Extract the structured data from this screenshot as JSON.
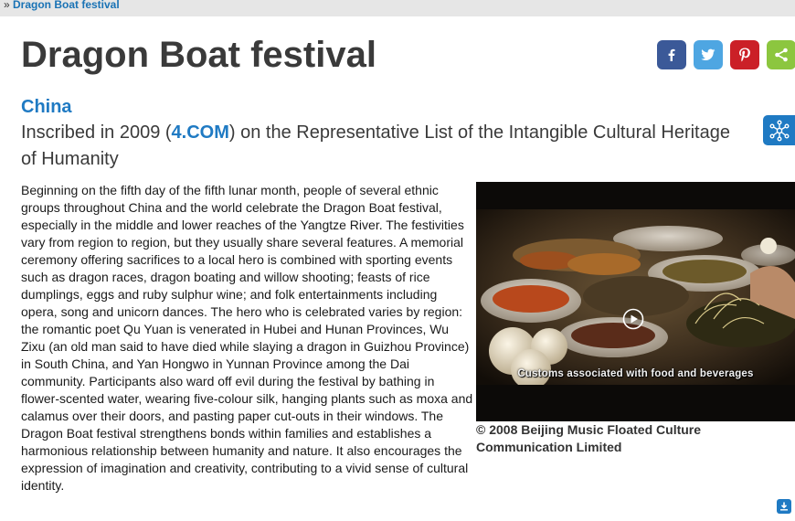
{
  "breadcrumb": {
    "separator": "»",
    "current": "Dragon Boat festival"
  },
  "page": {
    "title": "Dragon Boat festival",
    "country": "China",
    "inscription_prefix": "Inscribed in 2009 (",
    "inscription_link": "4.COM",
    "inscription_suffix": ") on the Representative List of the Intangible Cultural Heritage of Humanity"
  },
  "share": {
    "facebook_icon": "facebook-icon",
    "twitter_icon": "twitter-icon",
    "pinterest_icon": "pinterest-icon",
    "share_icon": "share-icon",
    "colors": {
      "facebook": "#3b5998",
      "twitter": "#4ea6e2",
      "pinterest": "#cb2027",
      "share": "#8cc63f"
    }
  },
  "description": "Beginning on the fifth day of the fifth lunar month, people of several ethnic groups throughout China and the world celebrate the Dragon Boat festival, especially in the middle and lower reaches of the Yangtze River. The festivities vary from region to region, but they usually share several features. A memorial ceremony offering sacrifices to a local hero is combined with sporting events such as dragon races, dragon boating and willow shooting; feasts of rice dumplings, eggs and ruby sulphur wine; and folk entertainments including opera, song and unicorn dances. The hero who is celebrated varies by region: the romantic poet Qu Yuan is venerated in Hubei and Hunan Provinces, Wu Zixu (an old man said to have died while slaying a dragon in Guizhou Province) in South China, and Yan Hongwo in Yunnan Province among the Dai community. Participants also ward off evil during the festival by bathing in flower-scented water, wearing five-colour silk, hanging plants such as moxa and calamus over their doors, and pasting paper cut-outs in their windows. The Dragon Boat festival strengthens bonds within families and establishes a harmonious relationship between humanity and nature. It also encourages the expression of imagination and creativity, contributing to a vivid sense of cultural identity.",
  "video": {
    "caption": "Customs associated with food and beverages",
    "play_icon": "play-icon",
    "credit": "© 2008 Beijing Music Floated Culture Communication Limited"
  },
  "accent_color": "#1f7ac3"
}
